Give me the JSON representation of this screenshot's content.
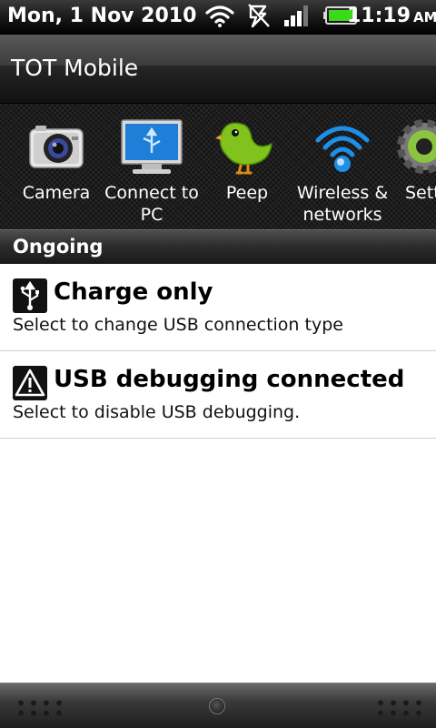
{
  "status_bar": {
    "date": "Mon, 1 Nov 2010",
    "time": "11:19",
    "ampm": "AM",
    "icons": [
      "wifi-icon",
      "vibrate-icon",
      "signal-icon",
      "battery-icon"
    ]
  },
  "carrier": {
    "name": "TOT Mobile"
  },
  "quick_settings": [
    {
      "icon": "camera-icon",
      "label": "Camera"
    },
    {
      "icon": "monitor-usb-icon",
      "label": "Connect to\nPC"
    },
    {
      "icon": "peep-bird-icon",
      "label": "Peep"
    },
    {
      "icon": "wireless-icon",
      "label": "Wireless &\nnetworks"
    },
    {
      "icon": "settings-gear-icon",
      "label": "Settings"
    }
  ],
  "ongoing": {
    "title": "Ongoing"
  },
  "notifications": [
    {
      "icon": "usb-icon",
      "title": "Charge only",
      "subtitle": "Select to change USB connection type"
    },
    {
      "icon": "warning-icon",
      "title": "USB debugging connected",
      "subtitle": "Select to disable USB debugging."
    }
  ],
  "colors": {
    "accent_green": "#7fc31c",
    "battery_green": "#3cd81a",
    "wifi_blue": "#1e8fe6"
  }
}
